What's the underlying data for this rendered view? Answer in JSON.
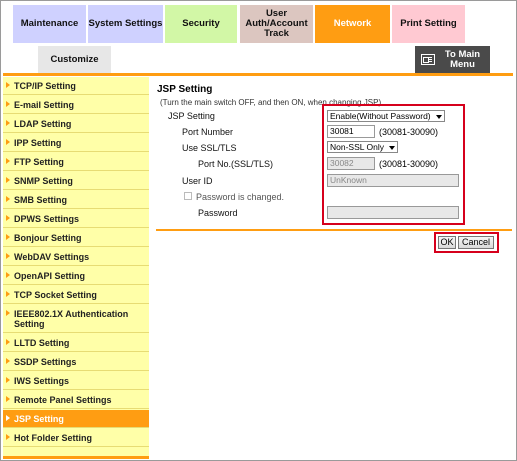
{
  "tabs": {
    "maintenance": "Maintenance",
    "system_settings": "System Settings",
    "security": "Security",
    "user_auth": "User Auth/Account Track",
    "network": "Network",
    "print_setting": "Print Setting",
    "customize": "Customize"
  },
  "to_main_menu": "To Main Menu",
  "sidebar": {
    "items": [
      {
        "label": "TCP/IP Setting"
      },
      {
        "label": "E-mail Setting"
      },
      {
        "label": "LDAP Setting"
      },
      {
        "label": "IPP Setting"
      },
      {
        "label": "FTP Setting"
      },
      {
        "label": "SNMP Setting"
      },
      {
        "label": "SMB Setting"
      },
      {
        "label": "DPWS Settings"
      },
      {
        "label": "Bonjour Setting"
      },
      {
        "label": "WebDAV Settings"
      },
      {
        "label": "OpenAPI Setting"
      },
      {
        "label": "TCP Socket Setting"
      },
      {
        "label": "IEEE802.1X Authentication Setting"
      },
      {
        "label": "LLTD Setting"
      },
      {
        "label": "SSDP Settings"
      },
      {
        "label": "IWS Settings"
      },
      {
        "label": "Remote Panel Settings"
      },
      {
        "label": "JSP Setting"
      },
      {
        "label": "Hot Folder Setting"
      }
    ],
    "active": "JSP Setting"
  },
  "content": {
    "title": "JSP Setting",
    "note": "(Turn the main switch OFF, and then ON, when changing JSP)",
    "jsp_setting_label": "JSP Setting",
    "jsp_setting_value": "Enable(Without Password)",
    "port_number_label": "Port Number",
    "port_number_value": "30081",
    "port_number_range": "(30081-30090)",
    "use_ssl_label": "Use SSL/TLS",
    "use_ssl_value": "Non-SSL Only",
    "port_ssl_label": "Port No.(SSL/TLS)",
    "port_ssl_value": "30082",
    "port_ssl_range": "(30081-30090)",
    "user_id_label": "User ID",
    "user_id_value": "UnKnown",
    "password_changed_label": "Password is changed.",
    "password_label": "Password",
    "password_value": ""
  },
  "buttons": {
    "ok": "OK",
    "cancel": "Cancel"
  },
  "colors": {
    "accent": "#ff9d12",
    "highlight_box": "#d6001c",
    "sidebar_bg": "#ffffa8"
  }
}
